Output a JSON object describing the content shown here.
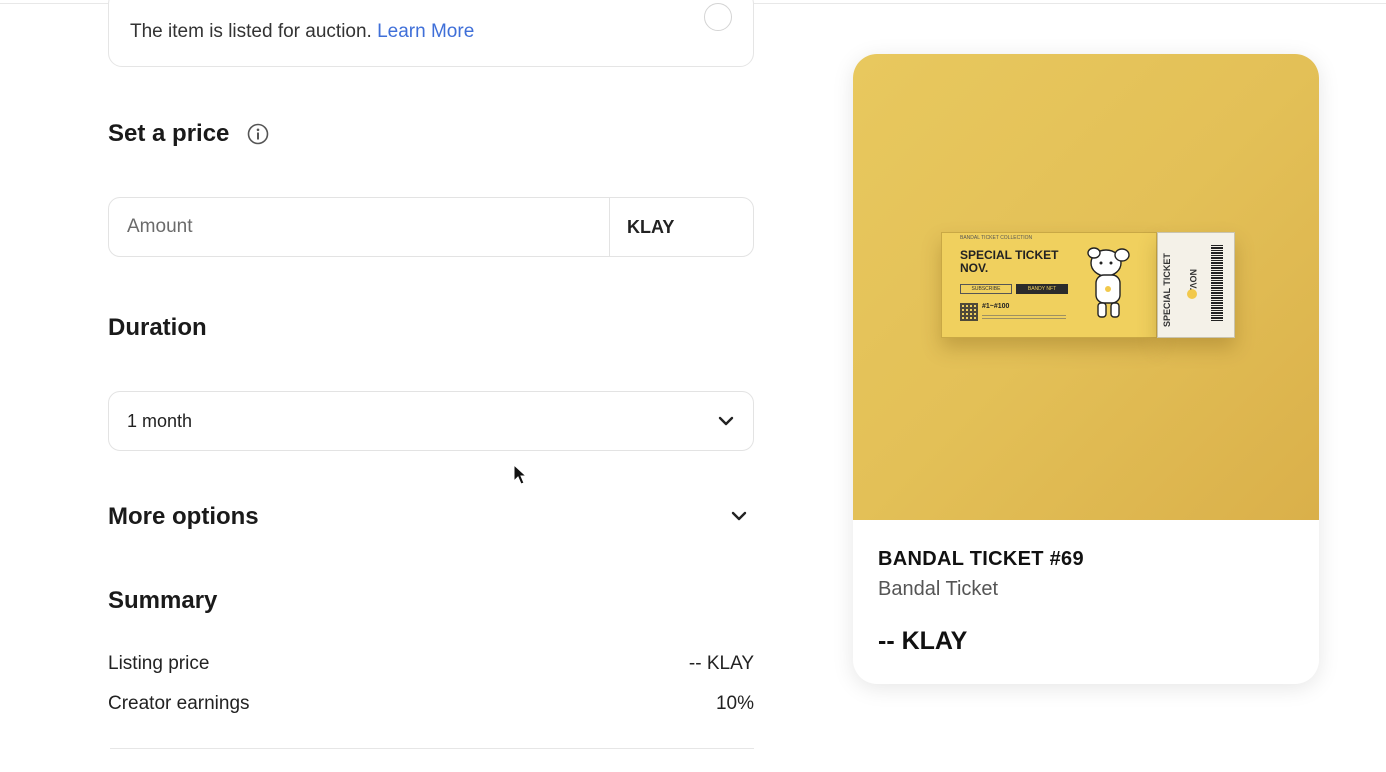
{
  "auction": {
    "text": "The item is listed for auction.",
    "link": "Learn More"
  },
  "price": {
    "title": "Set a price",
    "placeholder": "Amount",
    "currency": "KLAY"
  },
  "duration": {
    "title": "Duration",
    "selected": "1 month"
  },
  "more_options": {
    "title": "More options"
  },
  "summary": {
    "title": "Summary",
    "rows": [
      {
        "label": "Listing price",
        "value": "-- KLAY"
      },
      {
        "label": "Creator earnings",
        "value": "10%"
      }
    ]
  },
  "nft": {
    "name": "BANDAL TICKET #69",
    "collection": "Bandal Ticket",
    "price": "-- KLAY",
    "ticket": {
      "title": "SPECIAL TICKET NOV.",
      "subtitle": "BANDAL TICKET COLLECTION",
      "button_left": "SUBSCRIBE",
      "button_right": "BANDY NFT",
      "range": "#1~#100",
      "stub_text": "SPECIAL TICKET",
      "stub_nov": "NOV."
    },
    "colors": {
      "image_bg": "#e3c057",
      "ticket": "#f0d05e"
    }
  },
  "colors": {
    "link": "#3f6fd8"
  },
  "icons": [
    "info-icon",
    "chevron-down-icon",
    "mouse-cursor-icon"
  ]
}
